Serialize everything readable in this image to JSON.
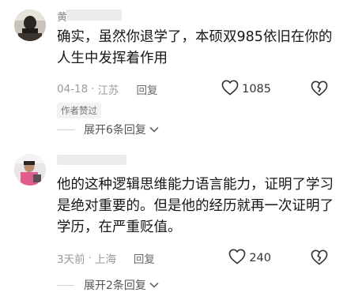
{
  "comments": [
    {
      "username": "黄",
      "text": "确实，虽然你退学了，本硕双985依旧在你的人生中发挥着作用",
      "date": "04-18",
      "location": "江苏",
      "reply_label": "回复",
      "likes": "1085",
      "badge": "作者赞过",
      "expand_label": "展开6条回复"
    },
    {
      "username": "",
      "text": "他的这种逻辑思维能力语言能力，证明了学习是绝对重要的。但是他的经历就再一次证明了学历，在严重贬值。",
      "date": "3天前",
      "location": "上海",
      "reply_label": "回复",
      "likes": "240",
      "expand_label": "展开2条回复"
    }
  ],
  "icons": {
    "like": "heart-outline-icon",
    "dislike": "broken-heart-icon",
    "expand": "chevron-down-icon"
  }
}
